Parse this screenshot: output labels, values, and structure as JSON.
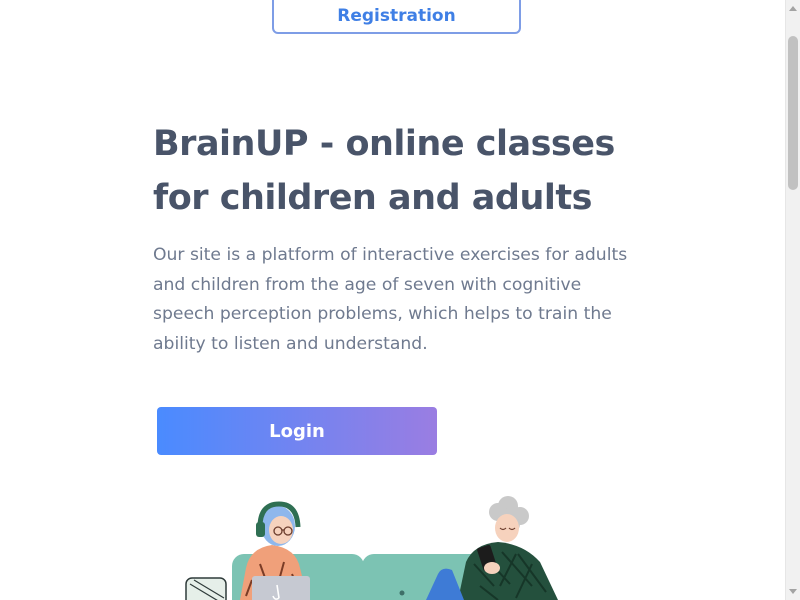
{
  "header": {
    "registration_label": "Registration"
  },
  "hero": {
    "title": "BrainUP - online classes for children and adults",
    "description": "Our site is a platform of interactive exercises for adults and children from the age of seven with cognitive speech perception problems, which helps to train the ability to listen and understand.",
    "login_label": "Login"
  },
  "colors": {
    "accent_blue": "#3f7fe5",
    "gradient_start": "#4a8bff",
    "gradient_end": "#9a7de2",
    "title": "#495469",
    "text": "#6f7a8f"
  },
  "icons": {
    "illustration": "people-on-sofa-illustration"
  }
}
